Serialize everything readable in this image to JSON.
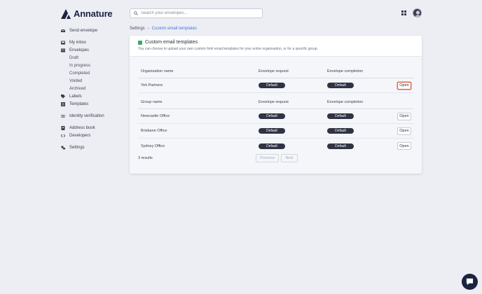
{
  "brand": {
    "name": "Annature"
  },
  "search": {
    "placeholder": "Search your envelopes..."
  },
  "sidebar": {
    "send_envelope": "Send envelope",
    "my_inbox": "My inbox",
    "envelopes": "Envelopes",
    "envelope_subitems": [
      "Draft",
      "In progress",
      "Completed",
      "Voided",
      "Archived"
    ],
    "labels": "Labels",
    "templates": "Templates",
    "identity_verification": "Identity verification",
    "address_book": "Address book",
    "developers": "Developers",
    "settings": "Settings"
  },
  "breadcrumb": {
    "parent": "Settings",
    "separator": "›",
    "current": "Custom email templates"
  },
  "card": {
    "title": "Custom email templates",
    "subtitle": "You can choose to upload your own custom html email templates for your entire organisation, or for a specific group."
  },
  "org_table": {
    "headers": [
      "Organisation name",
      "Envelope request",
      "Envelope completion"
    ],
    "rows": [
      {
        "name": "Yeti Partners",
        "request": "Default",
        "completion": "Default",
        "action": "Open"
      }
    ]
  },
  "group_table": {
    "headers": [
      "Group name",
      "Envelope request",
      "Envelope completion"
    ],
    "rows": [
      {
        "name": "Newcastle Office",
        "request": "Default",
        "completion": "Default",
        "action": "Open"
      },
      {
        "name": "Brisbane Office",
        "request": "Default",
        "completion": "Default",
        "action": "Open"
      },
      {
        "name": "Sydney Office",
        "request": "Default",
        "completion": "Default",
        "action": "Open"
      }
    ]
  },
  "footer": {
    "results": "3 results",
    "previous": "Previous",
    "next": "Next"
  },
  "colors": {
    "accent": "#4a72d6",
    "badge": "#2f3344",
    "focus": "#e0593a",
    "brand": "#1c2340"
  }
}
